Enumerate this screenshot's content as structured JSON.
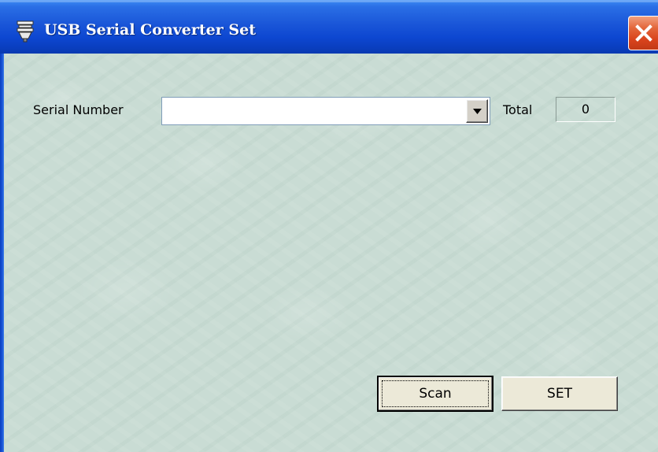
{
  "window": {
    "title": "USB Serial Converter Set",
    "icon": "usb-plug-icon",
    "close_icon": "close-icon"
  },
  "form": {
    "serial_label": "Serial Number",
    "serial_value": "",
    "total_label": "Total",
    "total_value": "0"
  },
  "buttons": {
    "scan_label": "Scan",
    "set_label": "SET"
  },
  "colors": {
    "titlebar": "#0d47d1",
    "close": "#d9431c",
    "background": "#c9dcd4"
  }
}
